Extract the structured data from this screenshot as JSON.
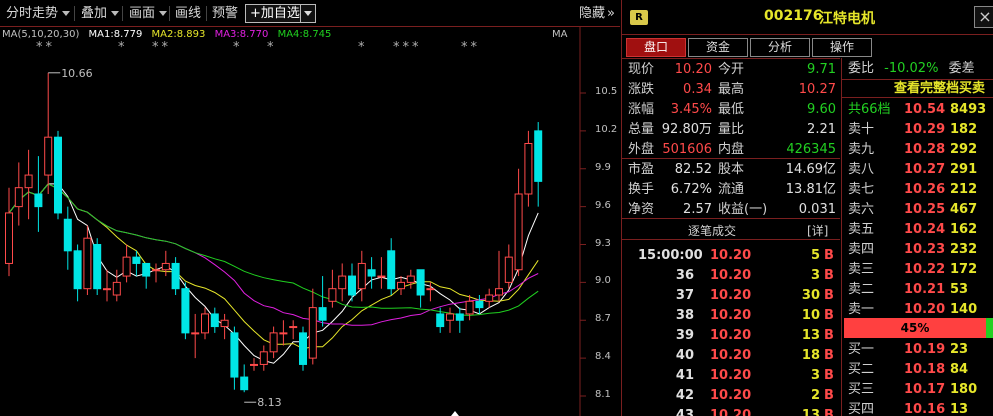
{
  "toolbar": {
    "intraday": "分时走势",
    "overlay": "叠加",
    "draw": "画面",
    "drawline": "画线",
    "alert": "预警",
    "add_fav": "+加自选",
    "hide": "隐藏",
    "hide_arrow": "»"
  },
  "ma_legend": {
    "ma": "MA(5,10,20,30)",
    "ma1": "MA1:8.779",
    "ma2": "MA2:8.893",
    "ma3": "MA3:8.770",
    "ma4": "MA4:8.745",
    "ma_right": "MA"
  },
  "colors": {
    "up": "#ff4a4a",
    "down": "#00e5e5",
    "ma1": "#ffffff",
    "ma2": "#e6e62a",
    "ma3": "#e020e0",
    "ma4": "#20d020",
    "grid": "#7a1f1f"
  },
  "stars": [
    "**",
    "*",
    "**",
    "*",
    "*",
    "*",
    "***",
    "**"
  ],
  "chart_data": {
    "type": "candlestick",
    "y_ticks": [
      "10.5",
      "10.2",
      "9.9",
      "9.6",
      "9.3",
      "9.0",
      "8.7",
      "8.4",
      "8.1"
    ],
    "ylim": [
      8.1,
      10.5
    ],
    "annotations": [
      {
        "text": "10.66",
        "kind": "high"
      },
      {
        "text": "8.13",
        "kind": "low"
      }
    ],
    "candles": [
      [
        9.15,
        9.55,
        9.75,
        9.05
      ],
      [
        9.6,
        9.75,
        9.95,
        9.45
      ],
      [
        9.75,
        9.85,
        10.05,
        9.5
      ],
      [
        9.7,
        9.6,
        10.0,
        9.4
      ],
      [
        9.85,
        10.15,
        10.66,
        9.7
      ],
      [
        10.15,
        9.55,
        10.2,
        9.5
      ],
      [
        9.5,
        9.25,
        9.6,
        9.1
      ],
      [
        9.25,
        8.95,
        9.3,
        8.85
      ],
      [
        8.95,
        9.35,
        9.45,
        8.9
      ],
      [
        9.3,
        8.95,
        9.35,
        8.9
      ],
      [
        8.95,
        8.95,
        9.1,
        8.85
      ],
      [
        8.9,
        9.0,
        9.1,
        8.85
      ],
      [
        9.05,
        9.2,
        9.3,
        9.0
      ],
      [
        9.2,
        9.15,
        9.25,
        9.05
      ],
      [
        9.15,
        9.05,
        9.15,
        8.95
      ],
      [
        9.1,
        9.1,
        9.15,
        9.0
      ],
      [
        9.1,
        9.15,
        9.25,
        9.05
      ],
      [
        9.15,
        8.95,
        9.2,
        8.9
      ],
      [
        8.95,
        8.6,
        9.0,
        8.55
      ],
      [
        8.6,
        8.6,
        8.75,
        8.4
      ],
      [
        8.6,
        8.75,
        8.8,
        8.55
      ],
      [
        8.75,
        8.65,
        8.8,
        8.6
      ],
      [
        8.65,
        8.7,
        8.75,
        8.55
      ],
      [
        8.6,
        8.25,
        8.65,
        8.15
      ],
      [
        8.25,
        8.15,
        8.35,
        8.13
      ],
      [
        8.35,
        8.35,
        8.4,
        8.3
      ],
      [
        8.35,
        8.45,
        8.5,
        8.3
      ],
      [
        8.45,
        8.6,
        8.65,
        8.4
      ],
      [
        8.6,
        8.6,
        8.7,
        8.5
      ],
      [
        8.65,
        8.65,
        8.7,
        8.55
      ],
      [
        8.6,
        8.35,
        8.65,
        8.3
      ],
      [
        8.4,
        8.8,
        8.95,
        8.35
      ],
      [
        8.8,
        8.7,
        9.05,
        8.65
      ],
      [
        8.85,
        8.95,
        9.1,
        8.8
      ],
      [
        8.95,
        9.05,
        9.15,
        8.85
      ],
      [
        9.05,
        8.9,
        9.15,
        8.85
      ],
      [
        8.95,
        9.15,
        9.25,
        8.85
      ],
      [
        9.1,
        9.05,
        9.2,
        8.95
      ],
      [
        9.05,
        9.05,
        9.2,
        8.95
      ],
      [
        9.25,
        8.95,
        9.35,
        8.9
      ],
      [
        8.95,
        9.0,
        9.05,
        8.9
      ],
      [
        9.0,
        9.05,
        9.1,
        8.95
      ],
      [
        9.1,
        8.9,
        9.1,
        8.8
      ],
      [
        8.95,
        8.95,
        9.0,
        8.85
      ],
      [
        8.75,
        8.65,
        8.8,
        8.6
      ],
      [
        8.7,
        8.75,
        8.8,
        8.6
      ],
      [
        8.75,
        8.7,
        8.8,
        8.6
      ],
      [
        8.75,
        8.85,
        8.9,
        8.7
      ],
      [
        8.85,
        8.8,
        8.9,
        8.75
      ],
      [
        8.85,
        8.9,
        8.95,
        8.8
      ],
      [
        8.9,
        8.95,
        9.25,
        8.85
      ],
      [
        9.0,
        9.2,
        9.3,
        8.95
      ],
      [
        9.1,
        9.7,
        9.9,
        9.05
      ],
      [
        9.7,
        10.1,
        10.2,
        9.6
      ],
      [
        10.2,
        9.8,
        10.27,
        9.6
      ]
    ]
  },
  "panel": {
    "badge": "R",
    "code": "002176",
    "name": "江特电机",
    "close": "×",
    "tabs": [
      "盘口",
      "资金",
      "分析",
      "操作"
    ],
    "quote": [
      {
        "l1": "现价",
        "v1": "10.20",
        "c1": "up",
        "l2": "今开",
        "v2": "9.71",
        "c2": "down"
      },
      {
        "l1": "涨跌",
        "v1": "0.34",
        "c1": "up",
        "l2": "最高",
        "v2": "10.27",
        "c2": "up"
      },
      {
        "l1": "涨幅",
        "v1": "3.45%",
        "c1": "up",
        "l2": "最低",
        "v2": "9.60",
        "c2": "down"
      },
      {
        "l1": "总量",
        "v1": "92.80万",
        "c1": "neutral",
        "l2": "量比",
        "v2": "2.21",
        "c2": "neutral"
      },
      {
        "l1": "外盘",
        "v1": "501606",
        "c1": "up",
        "l2": "内盘",
        "v2": "426345",
        "c2": "down"
      },
      {
        "l1": "市盈",
        "v1": "82.52",
        "c1": "neutral",
        "l2": "股本",
        "v2": "14.69亿",
        "c2": "neutral"
      },
      {
        "l1": "换手",
        "v1": "6.72%",
        "c1": "neutral",
        "l2": "流通",
        "v2": "13.81亿",
        "c2": "neutral"
      },
      {
        "l1": "净资",
        "v1": "2.57",
        "c1": "neutral",
        "l2": "收益(一)",
        "v2": "0.031",
        "c2": "neutral"
      }
    ],
    "ticks_title": "逐笔成交",
    "ticks_detail": "[详]",
    "ticks": [
      {
        "t": "15:00:00",
        "p": "10.20",
        "v": "5",
        "b": "B"
      },
      {
        "t": "36",
        "p": "10.20",
        "v": "3",
        "b": "B"
      },
      {
        "t": "37",
        "p": "10.20",
        "v": "30",
        "b": "B"
      },
      {
        "t": "38",
        "p": "10.20",
        "v": "10",
        "b": "B"
      },
      {
        "t": "39",
        "p": "10.20",
        "v": "13",
        "b": "B"
      },
      {
        "t": "40",
        "p": "10.20",
        "v": "18",
        "b": "B"
      },
      {
        "t": "41",
        "p": "10.20",
        "v": "3",
        "b": "B"
      },
      {
        "t": "42",
        "p": "10.20",
        "v": "2",
        "b": "B"
      },
      {
        "t": "43",
        "p": "10.20",
        "v": "13",
        "b": "B"
      }
    ],
    "orderbook": {
      "ratio_label": "委比",
      "ratio_value": "-10.02%",
      "diff_label": "委差",
      "full_label": "查看完整档买卖",
      "asks": [
        {
          "l": "共66档",
          "p": "10.54",
          "v": "8493"
        },
        {
          "l": "卖十",
          "p": "10.29",
          "v": "182"
        },
        {
          "l": "卖九",
          "p": "10.28",
          "v": "292"
        },
        {
          "l": "卖八",
          "p": "10.27",
          "v": "291"
        },
        {
          "l": "卖七",
          "p": "10.26",
          "v": "212"
        },
        {
          "l": "卖六",
          "p": "10.25",
          "v": "467"
        },
        {
          "l": "卖五",
          "p": "10.24",
          "v": "162"
        },
        {
          "l": "卖四",
          "p": "10.23",
          "v": "232"
        },
        {
          "l": "卖三",
          "p": "10.22",
          "v": "172"
        },
        {
          "l": "卖二",
          "p": "10.21",
          "v": "53"
        },
        {
          "l": "卖一",
          "p": "10.20",
          "v": "140"
        }
      ],
      "bar_red": "45%",
      "bar_green": "55",
      "bar_red_fraction": 0.45,
      "bids": [
        {
          "l": "买一",
          "p": "10.19",
          "v": "23"
        },
        {
          "l": "买二",
          "p": "10.18",
          "v": "84"
        },
        {
          "l": "买三",
          "p": "10.17",
          "v": "180"
        },
        {
          "l": "买四",
          "p": "10.16",
          "v": "13"
        }
      ]
    }
  }
}
